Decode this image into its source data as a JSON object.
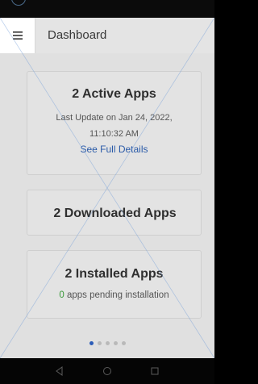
{
  "header": {
    "title": "Dashboard",
    "menu_icon": "hamburger-menu-icon"
  },
  "cards": {
    "active": {
      "title": "2 Active Apps",
      "update_line1": "Last Update on Jan 24, 2022,",
      "update_line2": "11:10:32 AM",
      "link": "See Full Details"
    },
    "downloaded": {
      "title": "2 Downloaded Apps"
    },
    "installed": {
      "title": "2 Installed Apps",
      "pending_count": "0",
      "pending_text": " apps pending installation"
    }
  },
  "pager": {
    "page_count": 5,
    "active_index": 0
  },
  "nav": {
    "back_icon": "back-triangle-icon",
    "home_icon": "home-circle-icon",
    "recents_icon": "recents-square-icon"
  },
  "colors": {
    "accent": "#2b5cb8",
    "link": "#2a5aa8",
    "pending": "#3b9a3b"
  }
}
